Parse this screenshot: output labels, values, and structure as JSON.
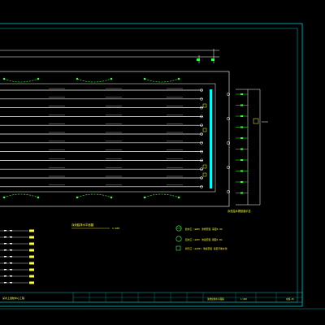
{
  "drawing": {
    "plan_title": "泳池給排水平面圖",
    "plan_scale": "1:100",
    "legend": [
      {
        "symbol": "circle-cross",
        "text": "給水口 (ø50) 池壁安裝 深度0.3m"
      },
      {
        "symbol": "circle",
        "text": "回水口 (ø50) 池底安裝 間距3.0m"
      },
      {
        "symbol": "square",
        "text": "排污口 (ø100) 池底安裝 接至平衡水池"
      }
    ],
    "right_side_note": "泳池溢水槽剖面示意",
    "detail_note": "平衡水池",
    "title_block": {
      "project": "某水上運動中心工程",
      "drawing_name": "泳池給排水平面圖",
      "scale": "1:100",
      "sheet": "水施-03"
    }
  },
  "colors": {
    "frame": "#00c8c8",
    "lines": "#ffffff",
    "green": "#3cff3c",
    "yellow": "#ffff3c",
    "cyan_fill": "#00ffff",
    "bg": "#000000"
  }
}
